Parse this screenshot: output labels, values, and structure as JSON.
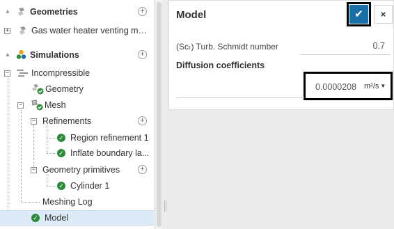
{
  "tree": {
    "geometries": {
      "label": "Geometries",
      "items": [
        {
          "label": "Gas water heater venting mal..."
        }
      ]
    },
    "simulations": {
      "label": "Simulations",
      "simulation": {
        "label": "Incompressible",
        "geometry": "Geometry",
        "mesh": {
          "label": "Mesh",
          "refinements": {
            "label": "Refinements",
            "items": [
              "Region refinement 1",
              "Inflate boundary la..."
            ]
          },
          "primitives": {
            "label": "Geometry primitives",
            "items": [
              "Cylinder 1"
            ]
          },
          "log": "Meshing Log"
        },
        "model": "Model"
      }
    }
  },
  "panel": {
    "title": "Model",
    "ok_icon": "✔",
    "close_icon": "×",
    "schmidt_label": "(Scₜ) Turb. Schmidt number",
    "schmidt_value": "0.7",
    "diffusion_label": "Diffusion coefficients",
    "diffusion_value": "0.0000208",
    "diffusion_unit": "m²/s"
  },
  "colors": {
    "accent": "#1a6fa8",
    "success": "#2e8b3c",
    "selected_row": "#dcebf7"
  }
}
